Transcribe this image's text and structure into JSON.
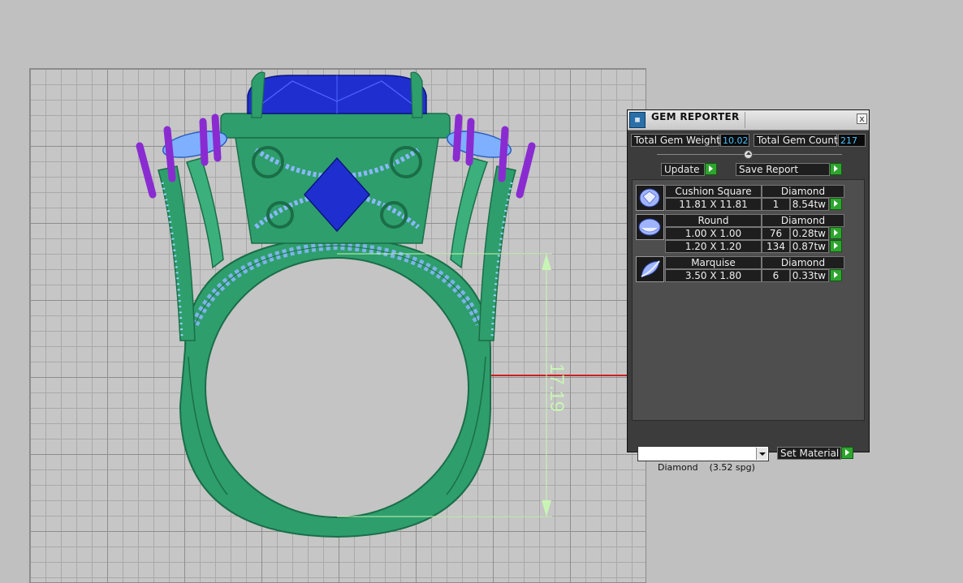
{
  "viewport": {
    "dimension_label": "17.19",
    "colors": {
      "metal": "#2e9e6c",
      "metal_dark": "#1d7a50",
      "center_stone": "#1f2fcf",
      "side_stones": "#7fb0ff",
      "prongs": "#8a2bd1",
      "x_axis": "#cc2020",
      "y_axis": "#2090c0",
      "dimension": "#c8f5b4"
    }
  },
  "gem_reporter": {
    "title": "GEM REPORTER",
    "close_glyph": "x",
    "total_weight_label": "Total Gem Weight",
    "total_weight_value": "10.02",
    "total_count_label": "Total Gem Count",
    "total_count_value": "217",
    "update_label": "Update",
    "save_report_label": "Save Report",
    "groups": [
      {
        "shape": "Cushion Square",
        "material": "Diamond",
        "icon": "cushion-gem-icon",
        "rows": [
          {
            "size": "11.81 X 11.81",
            "count": "1",
            "weight": "8.54tw"
          }
        ]
      },
      {
        "shape": "Round",
        "material": "Diamond",
        "icon": "round-gem-icon",
        "rows": [
          {
            "size": "1.00 X 1.00",
            "count": "76",
            "weight": "0.28tw"
          },
          {
            "size": "1.20 X 1.20",
            "count": "134",
            "weight": "0.87tw"
          }
        ]
      },
      {
        "shape": "Marquise",
        "material": "Diamond",
        "icon": "marquise-gem-icon",
        "rows": [
          {
            "size": "3.50 X 1.80",
            "count": "6",
            "weight": "0.33tw"
          }
        ]
      }
    ],
    "material_select_value": "Diamond    (3.52 spg)",
    "set_material_label": "Set Material"
  }
}
